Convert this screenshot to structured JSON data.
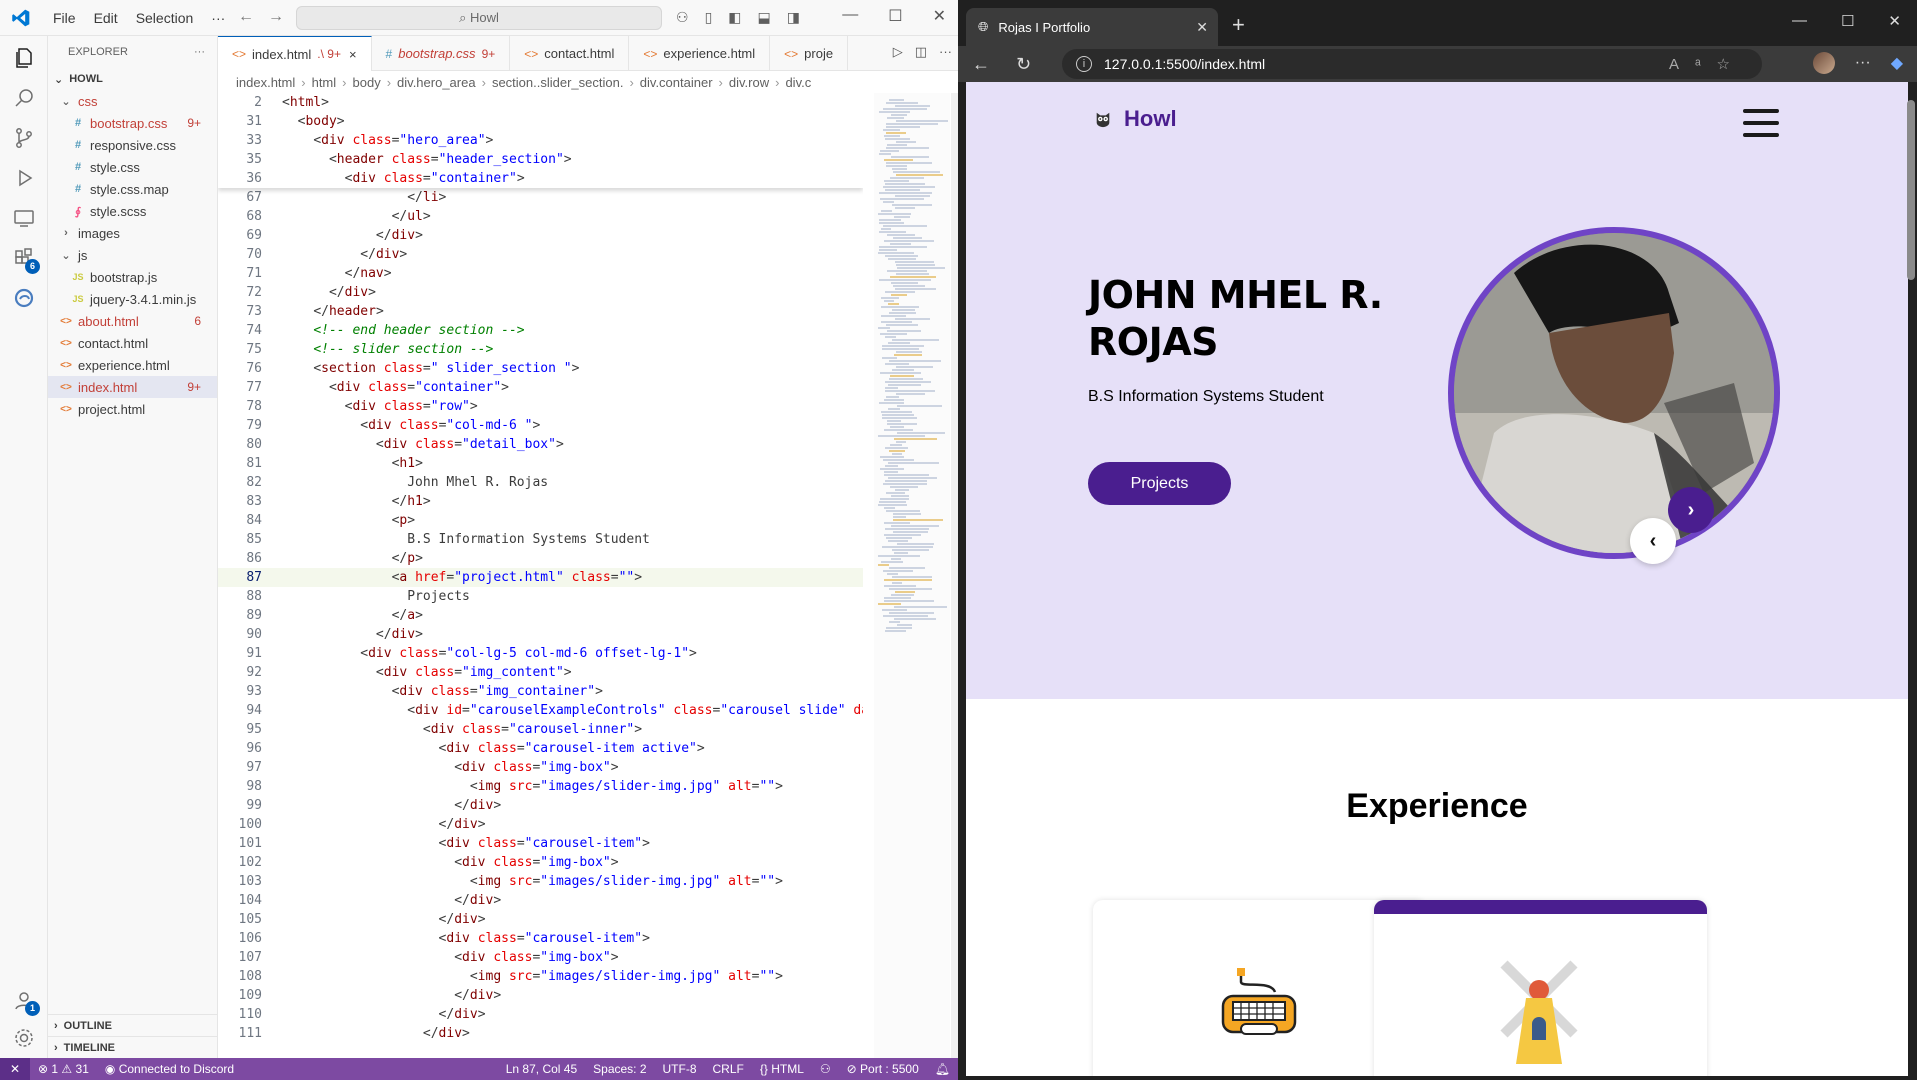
{
  "vscode": {
    "menu": [
      "File",
      "Edit",
      "Selection",
      "···"
    ],
    "command_center": "Howl",
    "explorer": {
      "title": "EXPLORER",
      "root": "HOWL",
      "items": [
        {
          "label": "css",
          "type": "folder",
          "indent": 1,
          "open": true,
          "color": "#c24038"
        },
        {
          "label": "bootstrap.css",
          "type": "css",
          "indent": 2,
          "count": "9+",
          "color": "#c24038"
        },
        {
          "label": "responsive.css",
          "type": "css",
          "indent": 2
        },
        {
          "label": "style.css",
          "type": "css",
          "indent": 2
        },
        {
          "label": "style.css.map",
          "type": "css",
          "indent": 2
        },
        {
          "label": "style.scss",
          "type": "scss",
          "indent": 2
        },
        {
          "label": "images",
          "type": "folder",
          "indent": 1,
          "open": false
        },
        {
          "label": "js",
          "type": "folder",
          "indent": 1,
          "open": true
        },
        {
          "label": "bootstrap.js",
          "type": "js",
          "indent": 2
        },
        {
          "label": "jquery-3.4.1.min.js",
          "type": "js",
          "indent": 2
        },
        {
          "label": "about.html",
          "type": "html",
          "indent": 1,
          "count": "6",
          "color": "#c24038"
        },
        {
          "label": "contact.html",
          "type": "html",
          "indent": 1
        },
        {
          "label": "experience.html",
          "type": "html",
          "indent": 1
        },
        {
          "label": "index.html",
          "type": "html",
          "indent": 1,
          "count": "9+",
          "color": "#c24038",
          "active": true
        },
        {
          "label": "project.html",
          "type": "html",
          "indent": 1
        }
      ],
      "outline": "OUTLINE",
      "timeline": "TIMELINE"
    },
    "tabs": [
      {
        "label": "index.html",
        "suffix": ".\\ 9+",
        "active": true,
        "close": "×"
      },
      {
        "label": "bootstrap.css",
        "suffix": "9+",
        "italic": true
      },
      {
        "label": "contact.html"
      },
      {
        "label": "experience.html"
      },
      {
        "label": "proje"
      }
    ],
    "breadcrumbs": [
      "index.html",
      "html",
      "body",
      "div.hero_area",
      "section..slider_section.",
      "div.container",
      "div.row",
      "div.c"
    ],
    "sticky_lines": [
      {
        "n": "2",
        "code": "<html>"
      },
      {
        "n": "31",
        "code": "  <body>"
      },
      {
        "n": "33",
        "code": "    <div class=\"hero_area\">"
      },
      {
        "n": "35",
        "code": "      <header class=\"header_section\">"
      },
      {
        "n": "36",
        "code": "        <div class=\"container\">"
      }
    ],
    "lines": [
      {
        "n": "67",
        "code": "                </li>"
      },
      {
        "n": "68",
        "code": "              </ul>"
      },
      {
        "n": "69",
        "code": "            </div>"
      },
      {
        "n": "70",
        "code": "          </div>"
      },
      {
        "n": "71",
        "code": "        </nav>"
      },
      {
        "n": "72",
        "code": "      </div>"
      },
      {
        "n": "73",
        "code": "    </header>"
      },
      {
        "n": "74",
        "code": "    <!-- end header section -->"
      },
      {
        "n": "75",
        "code": "    <!-- slider section -->"
      },
      {
        "n": "76",
        "code": "    <section class=\" slider_section \">"
      },
      {
        "n": "77",
        "code": "      <div class=\"container\">"
      },
      {
        "n": "78",
        "code": "        <div class=\"row\">"
      },
      {
        "n": "79",
        "code": "          <div class=\"col-md-6 \">"
      },
      {
        "n": "80",
        "code": "            <div class=\"detail_box\">"
      },
      {
        "n": "81",
        "code": "              <h1>"
      },
      {
        "n": "82",
        "code": "                John Mhel R. Rojas"
      },
      {
        "n": "83",
        "code": "              </h1>"
      },
      {
        "n": "84",
        "code": "              <p>"
      },
      {
        "n": "85",
        "code": "                B.S Information Systems Student"
      },
      {
        "n": "86",
        "code": "              </p>"
      },
      {
        "n": "87",
        "code": "              <a href=\"project.html\" class=\"\">"
      },
      {
        "n": "88",
        "code": "                Projects"
      },
      {
        "n": "89",
        "code": "              </a>"
      },
      {
        "n": "90",
        "code": "            </div>"
      },
      {
        "n": "91",
        "code": "          <div class=\"col-lg-5 col-md-6 offset-lg-1\">"
      },
      {
        "n": "92",
        "code": "            <div class=\"img_content\">"
      },
      {
        "n": "93",
        "code": "              <div class=\"img_container\">"
      },
      {
        "n": "94",
        "code": "                <div id=\"carouselExampleControls\" class=\"carousel slide\" da"
      },
      {
        "n": "95",
        "code": "                  <div class=\"carousel-inner\">"
      },
      {
        "n": "96",
        "code": "                    <div class=\"carousel-item active\">"
      },
      {
        "n": "97",
        "code": "                      <div class=\"img-box\">"
      },
      {
        "n": "98",
        "code": "                        <img src=\"images/slider-img.jpg\" alt=\"\">"
      },
      {
        "n": "99",
        "code": "                      </div>"
      },
      {
        "n": "100",
        "code": "                    </div>"
      },
      {
        "n": "101",
        "code": "                    <div class=\"carousel-item\">"
      },
      {
        "n": "102",
        "code": "                      <div class=\"img-box\">"
      },
      {
        "n": "103",
        "code": "                        <img src=\"images/slider-img.jpg\" alt=\"\">"
      },
      {
        "n": "104",
        "code": "                      </div>"
      },
      {
        "n": "105",
        "code": "                    </div>"
      },
      {
        "n": "106",
        "code": "                    <div class=\"carousel-item\">"
      },
      {
        "n": "107",
        "code": "                      <div class=\"img-box\">"
      },
      {
        "n": "108",
        "code": "                        <img src=\"images/slider-img.jpg\" alt=\"\">"
      },
      {
        "n": "109",
        "code": "                      </div>"
      },
      {
        "n": "110",
        "code": "                    </div>"
      },
      {
        "n": "111",
        "code": "                  </div>"
      }
    ],
    "current_line": "87",
    "status": {
      "errors": "1",
      "warnings": "31",
      "discord": "Connected to Discord",
      "position": "Ln 87, Col 45",
      "spaces": "Spaces: 2",
      "encoding": "UTF-8",
      "eol": "CRLF",
      "language": "HTML",
      "port": "Port : 5500"
    },
    "badges": {
      "extensions": "6",
      "accounts": "1"
    }
  },
  "browser": {
    "tab_title": "Rojas I Portfolio",
    "url": "127.0.0.1:5500/index.html",
    "site": {
      "brand": "Howl",
      "hero_name": "JOHN MHEL R. ROJAS",
      "hero_subtitle": "B.S Information Systems Student",
      "hero_button": "Projects",
      "section_title": "Experience"
    },
    "colors": {
      "primary": "#4a1e8f",
      "hero_bg": "#e6e0f8",
      "ring": "#6f44c6"
    }
  }
}
